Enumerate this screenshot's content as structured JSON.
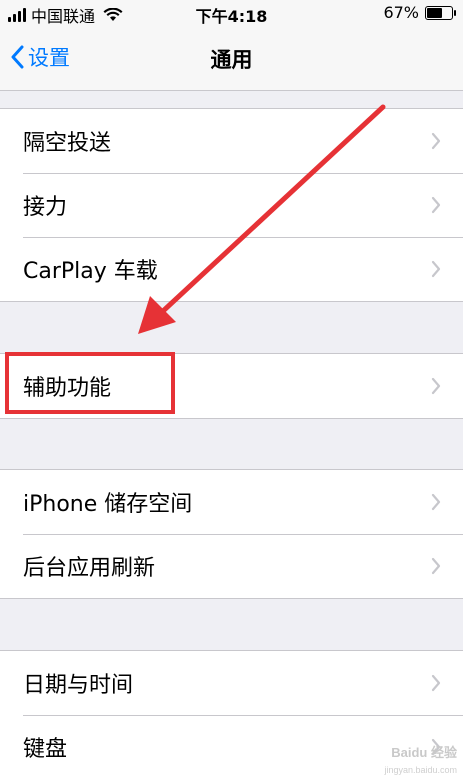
{
  "status_bar": {
    "carrier": "中国联通",
    "time": "下午4:18",
    "battery": "67%",
    "battery_level": 0.67
  },
  "nav": {
    "back_label": "设置",
    "title": "通用"
  },
  "groups": [
    {
      "items": [
        "隔空投送",
        "接力",
        "CarPlay 车载"
      ]
    },
    {
      "items": [
        "辅助功能"
      ]
    },
    {
      "items": [
        "iPhone 储存空间",
        "后台应用刷新"
      ]
    },
    {
      "items": [
        "日期与时间",
        "键盘"
      ]
    }
  ],
  "annotation": {
    "highlight_color": "#e63236",
    "highlighted_item": "辅助功能"
  },
  "watermark": {
    "text": "Baidu 经验",
    "url": "jingyan.baidu.com"
  }
}
